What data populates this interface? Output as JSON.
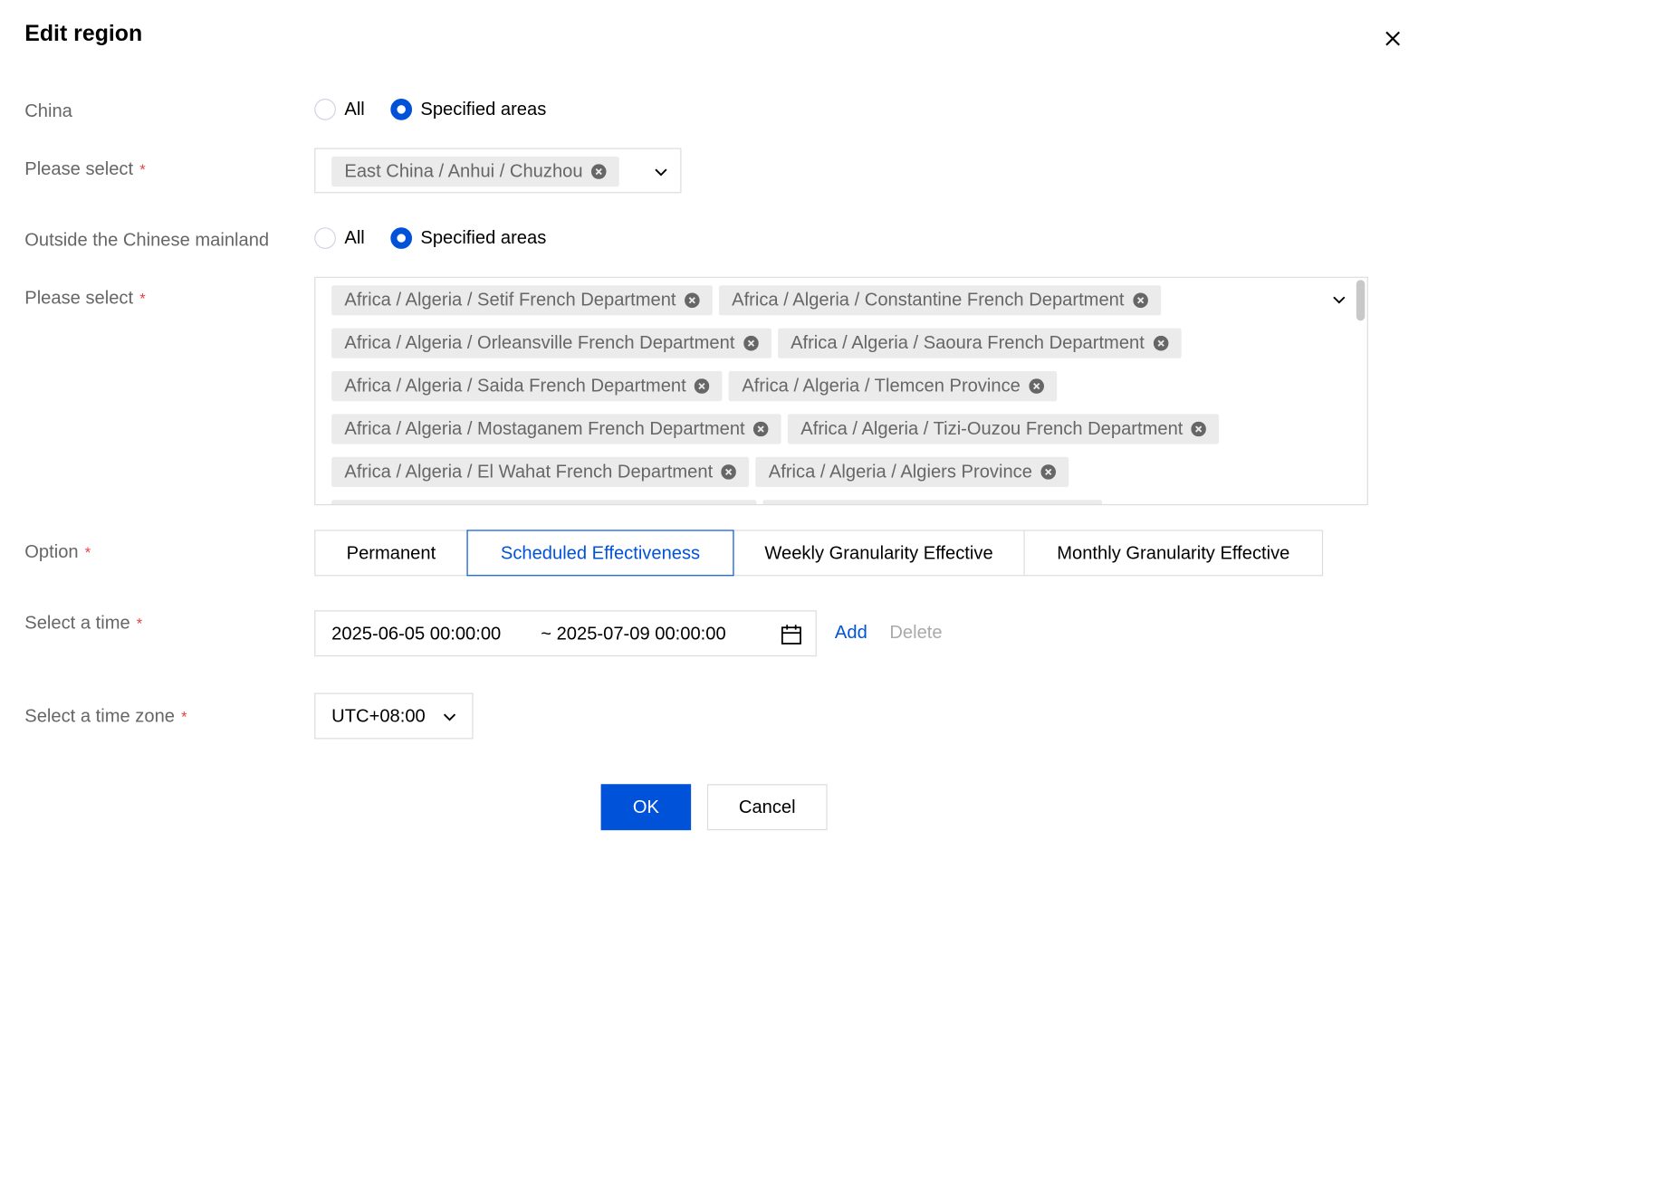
{
  "dialog": {
    "title": "Edit region"
  },
  "icons": {
    "close": "close-icon",
    "tag_remove": "circle-x-icon",
    "dropdown": "chevron-down-icon",
    "calendar": "calendar-icon"
  },
  "colors": {
    "primary": "#0052d9",
    "required": "#e54545",
    "label": "#666666",
    "tag_bg": "#ebebeb",
    "border": "#dcdcdc"
  },
  "china": {
    "label": "China",
    "options": [
      "All",
      "Specified areas"
    ],
    "selected": "Specified areas",
    "select_label": "Please select",
    "tags": [
      "East China / Anhui / Chuzhou"
    ]
  },
  "outside": {
    "label": "Outside the Chinese mainland",
    "options": [
      "All",
      "Specified areas"
    ],
    "selected": "Specified areas",
    "select_label": "Please select",
    "tags": [
      "Africa / Algeria / Setif French Department",
      "Africa / Algeria / Constantine French Department",
      "Africa / Algeria / Orleansville French Department",
      "Africa / Algeria / Saoura French Department",
      "Africa / Algeria / Saida French Department",
      "Africa / Algeria / Tlemcen Province",
      "Africa / Algeria / Mostaganem French Department",
      "Africa / Algeria / Tizi-Ouzou French Department",
      "Africa / Algeria / El Wahat French Department",
      "Africa / Algeria / Algiers Province"
    ]
  },
  "option": {
    "label": "Option",
    "segments": [
      "Permanent",
      "Scheduled Effectiveness",
      "Weekly Granularity Effective",
      "Monthly Granularity Effective"
    ],
    "active": "Scheduled Effectiveness"
  },
  "time": {
    "label": "Select a time",
    "start": "2025-06-05 00:00:00",
    "end": "~ 2025-07-09 00:00:00",
    "add": "Add",
    "delete": "Delete"
  },
  "timezone": {
    "label": "Select a time zone",
    "value": "UTC+08:00"
  },
  "footer": {
    "ok": "OK",
    "cancel": "Cancel"
  }
}
